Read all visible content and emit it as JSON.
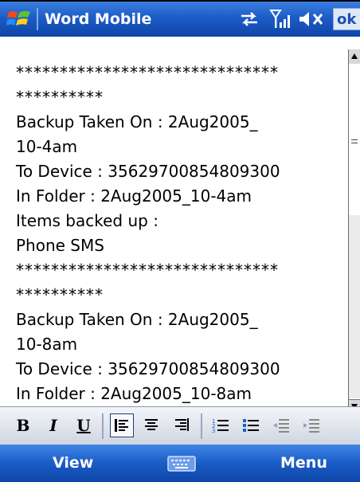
{
  "window": {
    "app_title": "Word Mobile",
    "ok_label": "ok"
  },
  "document": {
    "lines": [
      {
        "text": "******************************",
        "style": "stars"
      },
      {
        "text": "**********",
        "style": "stars"
      },
      {
        "text": "Backup Taken On : 2Aug2005_",
        "style": "normal"
      },
      {
        "text": "10-4am",
        "style": "normal"
      },
      {
        "text": "To Device : 35629700854809300",
        "style": "normal"
      },
      {
        "text": "In Folder : 2Aug2005_10-4am",
        "style": "normal"
      },
      {
        "text": "Items backed up :",
        "style": "normal"
      },
      {
        "text": "Phone SMS",
        "style": "normal"
      },
      {
        "text": "******************************",
        "style": "stars"
      },
      {
        "text": "**********",
        "style": "stars"
      },
      {
        "text": "Backup Taken On : 2Aug2005_",
        "style": "normal"
      },
      {
        "text": "10-8am",
        "style": "normal"
      },
      {
        "text": "To Device : 35629700854809300",
        "style": "normal"
      },
      {
        "text": "In Folder : 2Aug2005_10-8am",
        "style": "normal"
      }
    ]
  },
  "toolbar": {
    "bold_label": "B",
    "italic_label": "I",
    "underline_label": "U"
  },
  "softkeys": {
    "left_label": "View",
    "right_label": "Menu"
  }
}
